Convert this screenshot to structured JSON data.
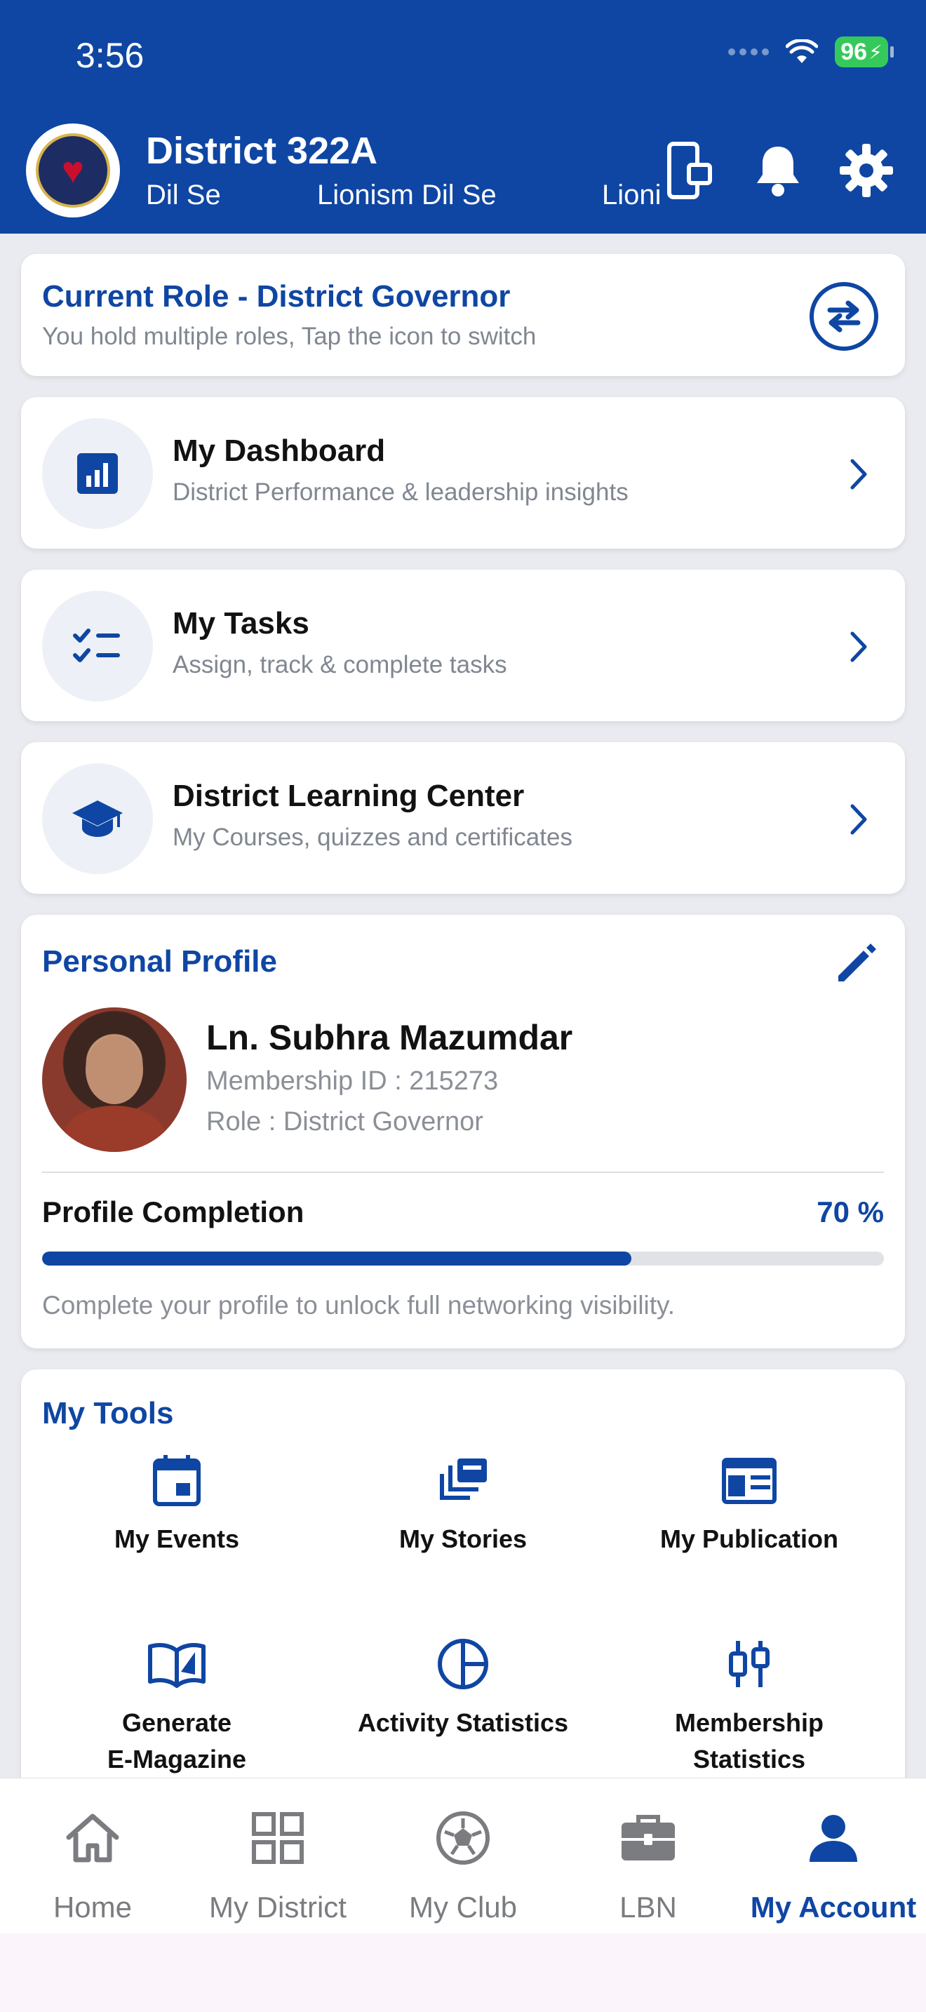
{
  "status_bar": {
    "time": "3:56",
    "battery": "96"
  },
  "header": {
    "title": "District 322A",
    "marquee": [
      "Dil Se",
      "Lionism Dil Se",
      "Lioni"
    ]
  },
  "role_card": {
    "title": "Current Role - District Governor",
    "subtitle": "You hold multiple roles, Tap the icon to switch"
  },
  "menu": [
    {
      "title": "My Dashboard",
      "subtitle": "District Performance & leadership insights",
      "icon": "bar-chart-icon"
    },
    {
      "title": "My Tasks",
      "subtitle": "Assign, track & complete tasks",
      "icon": "checklist-icon"
    },
    {
      "title": "District Learning Center",
      "subtitle": "My Courses, quizzes and certificates",
      "icon": "graduation-cap-icon"
    }
  ],
  "profile": {
    "section_title": "Personal Profile",
    "name": "Ln. Subhra Mazumdar",
    "membership": "Membership ID : 215273",
    "role": "Role : District Governor",
    "completion_label": "Profile Completion",
    "completion_text": "70 %",
    "completion_fraction": 0.7,
    "note": "Complete your profile to unlock full networking visibility."
  },
  "tools": {
    "title": "My Tools",
    "items": [
      {
        "label": "My Events",
        "icon": "calendar-icon"
      },
      {
        "label": "My Stories",
        "icon": "stories-icon"
      },
      {
        "label": "My Publication",
        "icon": "publication-icon"
      },
      {
        "label": "Generate E-Magazine",
        "line1": "Generate",
        "line2": "E-Magazine",
        "icon": "book-icon"
      },
      {
        "label": "Activity Statistics",
        "icon": "pie-chart-icon"
      },
      {
        "label": "Membership Statistics",
        "line1": "Membership",
        "line2": "Statistics",
        "icon": "sliders-icon"
      }
    ]
  },
  "tabs": [
    {
      "label": "Home",
      "icon": "home-icon"
    },
    {
      "label": "My District",
      "icon": "grid-icon"
    },
    {
      "label": "My Club",
      "icon": "ball-icon"
    },
    {
      "label": "LBN",
      "icon": "briefcase-icon"
    },
    {
      "label": "My Account",
      "icon": "person-icon",
      "active": true
    }
  ],
  "colors": {
    "primary": "#0f46a3",
    "background": "#e9ebf0",
    "battery": "#35c95b"
  }
}
